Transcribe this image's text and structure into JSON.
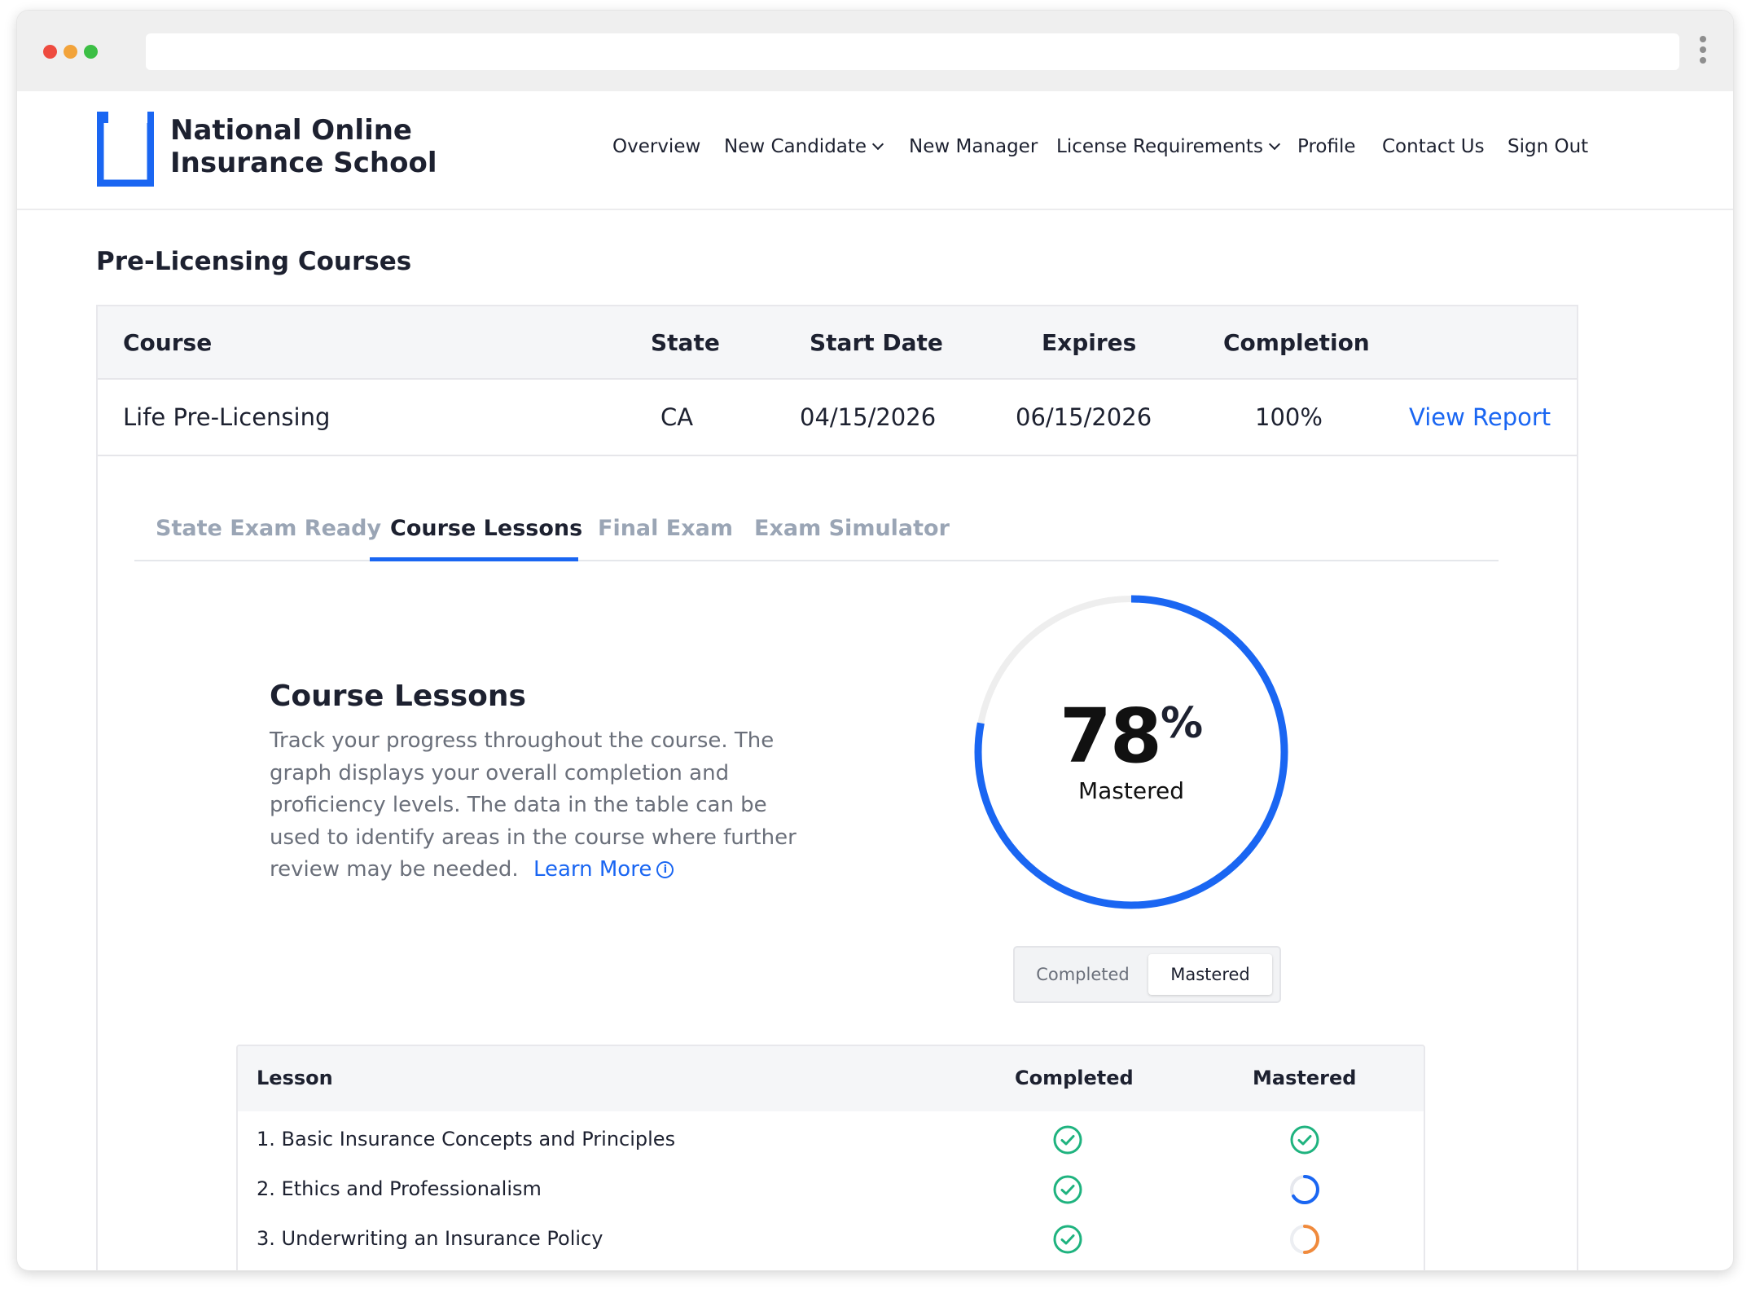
{
  "brand": {
    "name_line1": "National Online",
    "name_line2": "Insurance School",
    "accent": "#1a66f2"
  },
  "nav": {
    "overview": "Overview",
    "new_candidate": "New Candidate",
    "new_manager": "New Manager",
    "license_requirements": "License Requirements",
    "profile": "Profile",
    "contact_us": "Contact Us",
    "sign_out": "Sign Out"
  },
  "page": {
    "title": "Pre-Licensing Courses"
  },
  "courses_table": {
    "headers": {
      "course": "Course",
      "state": "State",
      "start_date": "Start Date",
      "expires": "Expires",
      "completion": "Completion"
    },
    "rows": [
      {
        "course": "Life Pre-Licensing",
        "state": "CA",
        "start_date": "04/15/2026",
        "expires": "06/15/2026",
        "completion": "100%",
        "action": "View Report"
      }
    ]
  },
  "tabs": [
    {
      "label": "State Exam Ready",
      "active": false
    },
    {
      "label": "Course Lessons",
      "active": true
    },
    {
      "label": "Final Exam",
      "active": false
    },
    {
      "label": "Exam Simulator",
      "active": false
    }
  ],
  "lessons_panel": {
    "title": "Course Lessons",
    "description": "Track your progress throughout the course. The graph displays your overall completion and proficiency levels. The data in the table can be used to identify areas in the course where further review may be needed.",
    "learn_more": "Learn More",
    "info_icon": "info-icon"
  },
  "progress": {
    "percent_value": 78,
    "percent_number": "78",
    "percent_sign": "%",
    "label": "Mastered",
    "ring_color": "#1a66f2",
    "track_color": "#eeeeee"
  },
  "view_toggle": {
    "completed": "Completed",
    "mastered": "Mastered",
    "selected": "Mastered"
  },
  "lessons_table": {
    "headers": {
      "lesson": "Lesson",
      "completed": "Completed",
      "mastered": "Mastered"
    },
    "rows": [
      {
        "name": "1. Basic Insurance Concepts and Principles",
        "completed": "check",
        "mastered": "check"
      },
      {
        "name": "2. Ethics and Professionalism",
        "completed": "check",
        "mastered": "partial-blue"
      },
      {
        "name": "3. Underwriting an Insurance Policy",
        "completed": "check",
        "mastered": "partial-orange"
      }
    ],
    "status_colors": {
      "check": "#1fb37f",
      "partial-blue": "#1a66f2",
      "partial-orange": "#f08a3c"
    }
  }
}
